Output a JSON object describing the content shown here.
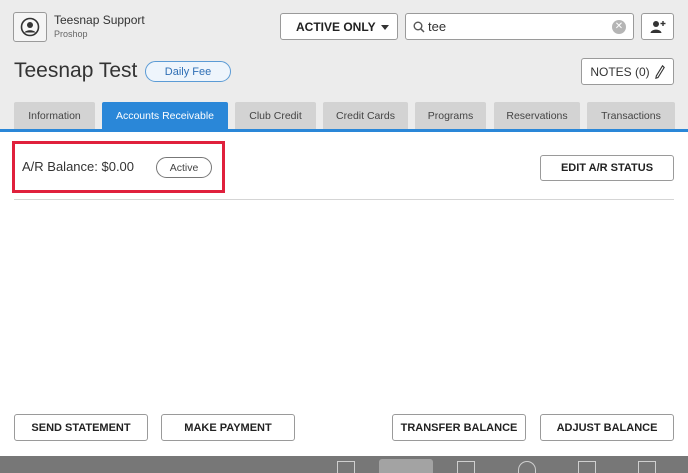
{
  "user": {
    "name": "Teesnap Support",
    "role": "Proshop"
  },
  "filter": {
    "selected": "ACTIVE ONLY"
  },
  "search": {
    "value": "tee"
  },
  "customer": {
    "name": "Teesnap Test",
    "badge": "Daily Fee"
  },
  "notes": {
    "label": "NOTES (0)"
  },
  "tabs": [
    {
      "label": "Information"
    },
    {
      "label": "Accounts Receivable"
    },
    {
      "label": "Club Credit"
    },
    {
      "label": "Credit Cards"
    },
    {
      "label": "Programs"
    },
    {
      "label": "Reservations"
    },
    {
      "label": "Transactions"
    }
  ],
  "ar": {
    "balance_label": "A/R Balance:  $0.00",
    "status": "Active",
    "edit_label": "EDIT A/R STATUS"
  },
  "footer": {
    "send_statement": "SEND STATEMENT",
    "make_payment": "MAKE PAYMENT",
    "transfer_balance": "TRANSFER BALANCE",
    "adjust_balance": "ADJUST BALANCE"
  },
  "colors": {
    "accent": "#2a87d8",
    "highlight": "#e0203c",
    "badge_border": "#5b9bd5"
  },
  "icons": {
    "user": "user-circle-icon",
    "search": "search-icon",
    "clear": "clear-icon",
    "add_user": "add-user-icon",
    "notes": "pencil-icon",
    "caret": "chevron-down-icon"
  }
}
